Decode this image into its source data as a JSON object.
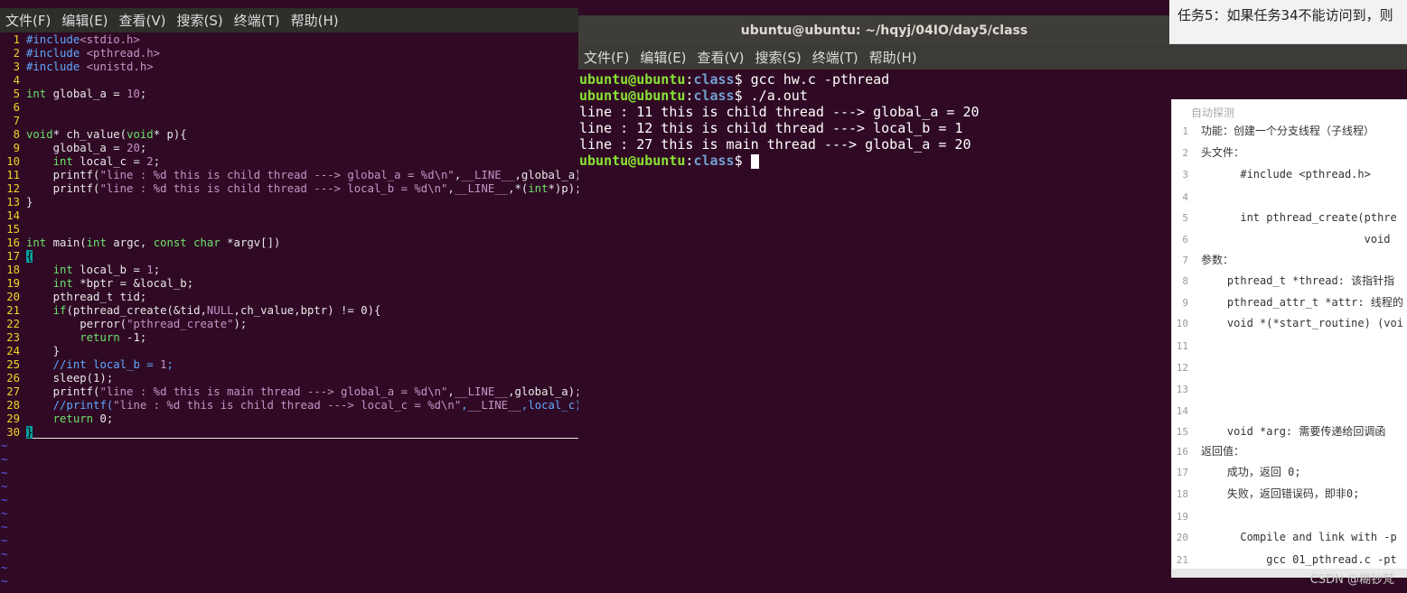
{
  "vim": {
    "menu": [
      "文件(F)",
      "编辑(E)",
      "查看(V)",
      "搜索(S)",
      "终端(T)",
      "帮助(H)"
    ],
    "lines": [
      {
        "n": "1",
        "t": "#include<stdio.h>"
      },
      {
        "n": "2",
        "t": "#include <pthread.h>"
      },
      {
        "n": "3",
        "t": "#include <unistd.h>"
      },
      {
        "n": "4",
        "t": ""
      },
      {
        "n": "5",
        "t": "int global_a = 10;"
      },
      {
        "n": "6",
        "t": ""
      },
      {
        "n": "7",
        "t": ""
      },
      {
        "n": "8",
        "t": "void* ch_value(void* p){"
      },
      {
        "n": "9",
        "t": "    global_a = 20;"
      },
      {
        "n": "10",
        "t": "    int local_c = 2;"
      },
      {
        "n": "11",
        "t": "    printf(\"line : %d this is child thread ---> global_a = %d\\n\",__LINE__,global_a);"
      },
      {
        "n": "12",
        "t": "    printf(\"line : %d this is child thread ---> local_b = %d\\n\",__LINE__,*(int*)p);"
      },
      {
        "n": "13",
        "t": "}"
      },
      {
        "n": "14",
        "t": ""
      },
      {
        "n": "15",
        "t": ""
      },
      {
        "n": "16",
        "t": "int main(int argc, const char *argv[])"
      },
      {
        "n": "17",
        "t": "{"
      },
      {
        "n": "18",
        "t": "    int local_b = 1;"
      },
      {
        "n": "19",
        "t": "    int *bptr = &local_b;"
      },
      {
        "n": "20",
        "t": "    pthread_t tid;"
      },
      {
        "n": "21",
        "t": "    if(pthread_create(&tid,NULL,ch_value,bptr) != 0){"
      },
      {
        "n": "22",
        "t": "        perror(\"pthread_create\");"
      },
      {
        "n": "23",
        "t": "        return -1;"
      },
      {
        "n": "24",
        "t": "    }"
      },
      {
        "n": "25",
        "t": "    //int local_b = 1;"
      },
      {
        "n": "26",
        "t": "    sleep(1);"
      },
      {
        "n": "27",
        "t": "    printf(\"line : %d this is main thread ---> global_a = %d\\n\",__LINE__,global_a);"
      },
      {
        "n": "28",
        "t": "    //printf(\"line : %d this is child thread ---> local_c = %d\\n\",__LINE__,local_c);"
      },
      {
        "n": "29",
        "t": "    return 0;"
      },
      {
        "n": "30",
        "t": "}"
      }
    ],
    "tilde": "~"
  },
  "terminal": {
    "title": "ubuntu@ubuntu: ~/hqyj/04IO/day5/class",
    "menu": [
      "文件(F)",
      "编辑(E)",
      "查看(V)",
      "搜索(S)",
      "终端(T)",
      "帮助(H)"
    ],
    "prompt_user": "ubuntu@ubuntu",
    "prompt_colon": ":",
    "prompt_path": "class",
    "prompt_dollar": "$ ",
    "cmd1": "gcc hw.c -pthread",
    "cmd2": "./a.out",
    "out1": "line : 11 this is child thread ---> global_a = 20",
    "out2": "line : 12 this is child thread ---> local_b = 1",
    "out3": "line : 27 this is main thread ---> global_a = 20"
  },
  "task": {
    "text": "任务5：如果任务34不能访问到，则"
  },
  "doc": {
    "header": "自动探测",
    "lines": [
      {
        "n": "1",
        "t": "功能：创建一个分支线程（子线程）"
      },
      {
        "n": "2",
        "t": "头文件："
      },
      {
        "n": "3",
        "t": "      #include <pthread.h>"
      },
      {
        "n": "4",
        "t": ""
      },
      {
        "n": "5",
        "t": "      int pthread_create(pthre"
      },
      {
        "n": "6",
        "t": "                         void"
      },
      {
        "n": "7",
        "t": "参数："
      },
      {
        "n": "8",
        "t": "    pthread_t *thread: 该指针指"
      },
      {
        "n": "9",
        "t": "    pthread_attr_t *attr: 线程的"
      },
      {
        "n": "10",
        "t": "    void *(*start_routine) (voi"
      },
      {
        "n": "11",
        "t": ""
      },
      {
        "n": "12",
        "t": ""
      },
      {
        "n": "13",
        "t": ""
      },
      {
        "n": "14",
        "t": ""
      },
      {
        "n": "15",
        "t": "    void *arg: 需要传递给回调函"
      },
      {
        "n": "16",
        "t": "返回值："
      },
      {
        "n": "17",
        "t": "    成功，返回 0;"
      },
      {
        "n": "18",
        "t": "    失败，返回错误码，即非0;"
      },
      {
        "n": "19",
        "t": ""
      },
      {
        "n": "20",
        "t": "      Compile and link with -p"
      },
      {
        "n": "21",
        "t": "          gcc 01_pthread.c -pt"
      }
    ]
  },
  "watermark": "CSDN @糊钞梵"
}
